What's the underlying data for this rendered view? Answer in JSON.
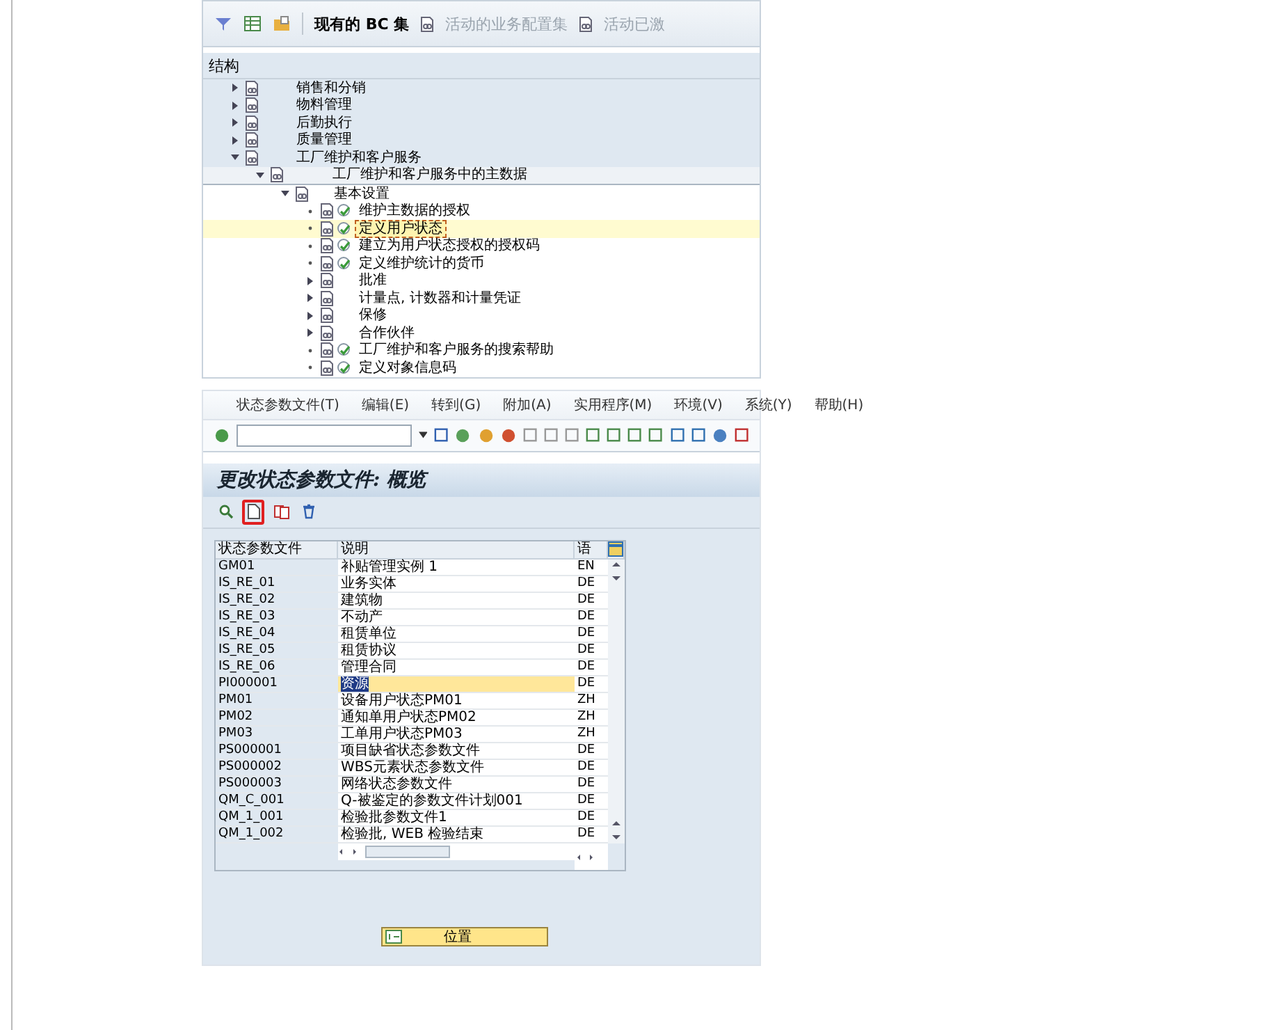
{
  "top_toolbar": {
    "items": [
      {
        "label": "现有的 BC 集",
        "disabled": false
      },
      {
        "label": "活动的业务配置集",
        "disabled": true
      },
      {
        "label": "活动已激",
        "disabled": true
      }
    ]
  },
  "structure": {
    "header": "结构",
    "tree": [
      {
        "label": "销售和分销",
        "kind": "folder",
        "expanded": false,
        "selected": false
      },
      {
        "label": "物料管理",
        "kind": "folder",
        "expanded": false,
        "selected": false
      },
      {
        "label": "后勤执行",
        "kind": "folder",
        "expanded": false,
        "selected": false
      },
      {
        "label": "质量管理",
        "kind": "folder",
        "expanded": false,
        "selected": false
      },
      {
        "label": "工厂维护和客户服务",
        "kind": "folder",
        "expanded": true,
        "selected": false,
        "children": [
          {
            "label": "工厂维护和客户服务中的主数据",
            "kind": "folder",
            "expanded": true,
            "selected": false,
            "children": [
              {
                "label": "基本设置",
                "kind": "folder",
                "expanded": true,
                "selected": false,
                "children": [
                  {
                    "label": "维护主数据的授权",
                    "kind": "activity",
                    "selected": false
                  },
                  {
                    "label": "定义用户状态",
                    "kind": "activity",
                    "selected": true
                  },
                  {
                    "label": "建立为用户状态授权的授权码",
                    "kind": "activity",
                    "selected": false
                  },
                  {
                    "label": "定义维护统计的货币",
                    "kind": "activity",
                    "selected": false
                  },
                  {
                    "label": "批准",
                    "kind": "folder",
                    "expanded": false,
                    "selected": false
                  },
                  {
                    "label": "计量点, 计数器和计量凭证",
                    "kind": "folder",
                    "expanded": false,
                    "selected": false
                  },
                  {
                    "label": "保修",
                    "kind": "folder",
                    "expanded": false,
                    "selected": false
                  },
                  {
                    "label": "合作伙伴",
                    "kind": "folder",
                    "expanded": false,
                    "selected": false
                  },
                  {
                    "label": "工厂维护和客户服务的搜索帮助",
                    "kind": "activity",
                    "selected": false
                  },
                  {
                    "label": "定义对象信息码",
                    "kind": "activity",
                    "selected": false
                  }
                ]
              }
            ]
          }
        ]
      }
    ]
  },
  "menu_bar": [
    "状态参数文件(T)",
    "编辑(E)",
    "转到(G)",
    "附加(A)",
    "实用程序(M)",
    "环境(V)",
    "系统(Y)",
    "帮助(H)"
  ],
  "title": "更改状态参数文件: 概览",
  "app_toolbar": [
    {
      "highlighted": false
    },
    {
      "highlighted": true
    },
    {
      "highlighted": false
    },
    {
      "highlighted": false
    }
  ],
  "table": {
    "columns": [
      "状态参数文件",
      "说明",
      "语"
    ],
    "rows": [
      {
        "cells": [
          "GM01",
          "补贴管理实例 1",
          "EN"
        ],
        "selected": false
      },
      {
        "cells": [
          "IS_RE_01",
          "业务实体",
          "DE"
        ],
        "selected": false
      },
      {
        "cells": [
          "IS_RE_02",
          "建筑物",
          "DE"
        ],
        "selected": false
      },
      {
        "cells": [
          "IS_RE_03",
          "不动产",
          "DE"
        ],
        "selected": false
      },
      {
        "cells": [
          "IS_RE_04",
          "租赁单位",
          "DE"
        ],
        "selected": false
      },
      {
        "cells": [
          "IS_RE_05",
          "租赁协议",
          "DE"
        ],
        "selected": false
      },
      {
        "cells": [
          "IS_RE_06",
          "管理合同",
          "DE"
        ],
        "selected": false
      },
      {
        "cells": [
          "PI000001",
          "资源",
          "DE"
        ],
        "selected": true
      },
      {
        "cells": [
          "PM01",
          "设备用户状态PM01",
          "ZH"
        ],
        "selected": false
      },
      {
        "cells": [
          "PM02",
          "通知单用户状态PM02",
          "ZH"
        ],
        "selected": false
      },
      {
        "cells": [
          "PM03",
          "工单用户状态PM03",
          "ZH"
        ],
        "selected": false
      },
      {
        "cells": [
          "PS000001",
          "项目缺省状态参数文件",
          "DE"
        ],
        "selected": false
      },
      {
        "cells": [
          "PS000002",
          "WBS元素状态参数文件",
          "DE"
        ],
        "selected": false
      },
      {
        "cells": [
          "PS000003",
          "网络状态参数文件",
          "DE"
        ],
        "selected": false
      },
      {
        "cells": [
          "QM_C_001",
          "Q-被鉴定的参数文件计划001",
          "DE"
        ],
        "selected": false
      },
      {
        "cells": [
          "QM_1_001",
          "检验批参数文件1",
          "DE"
        ],
        "selected": false
      },
      {
        "cells": [
          "QM_1_002",
          "检验批, WEB 检验结束",
          "DE"
        ],
        "selected": false
      }
    ]
  },
  "position_button": "位置"
}
